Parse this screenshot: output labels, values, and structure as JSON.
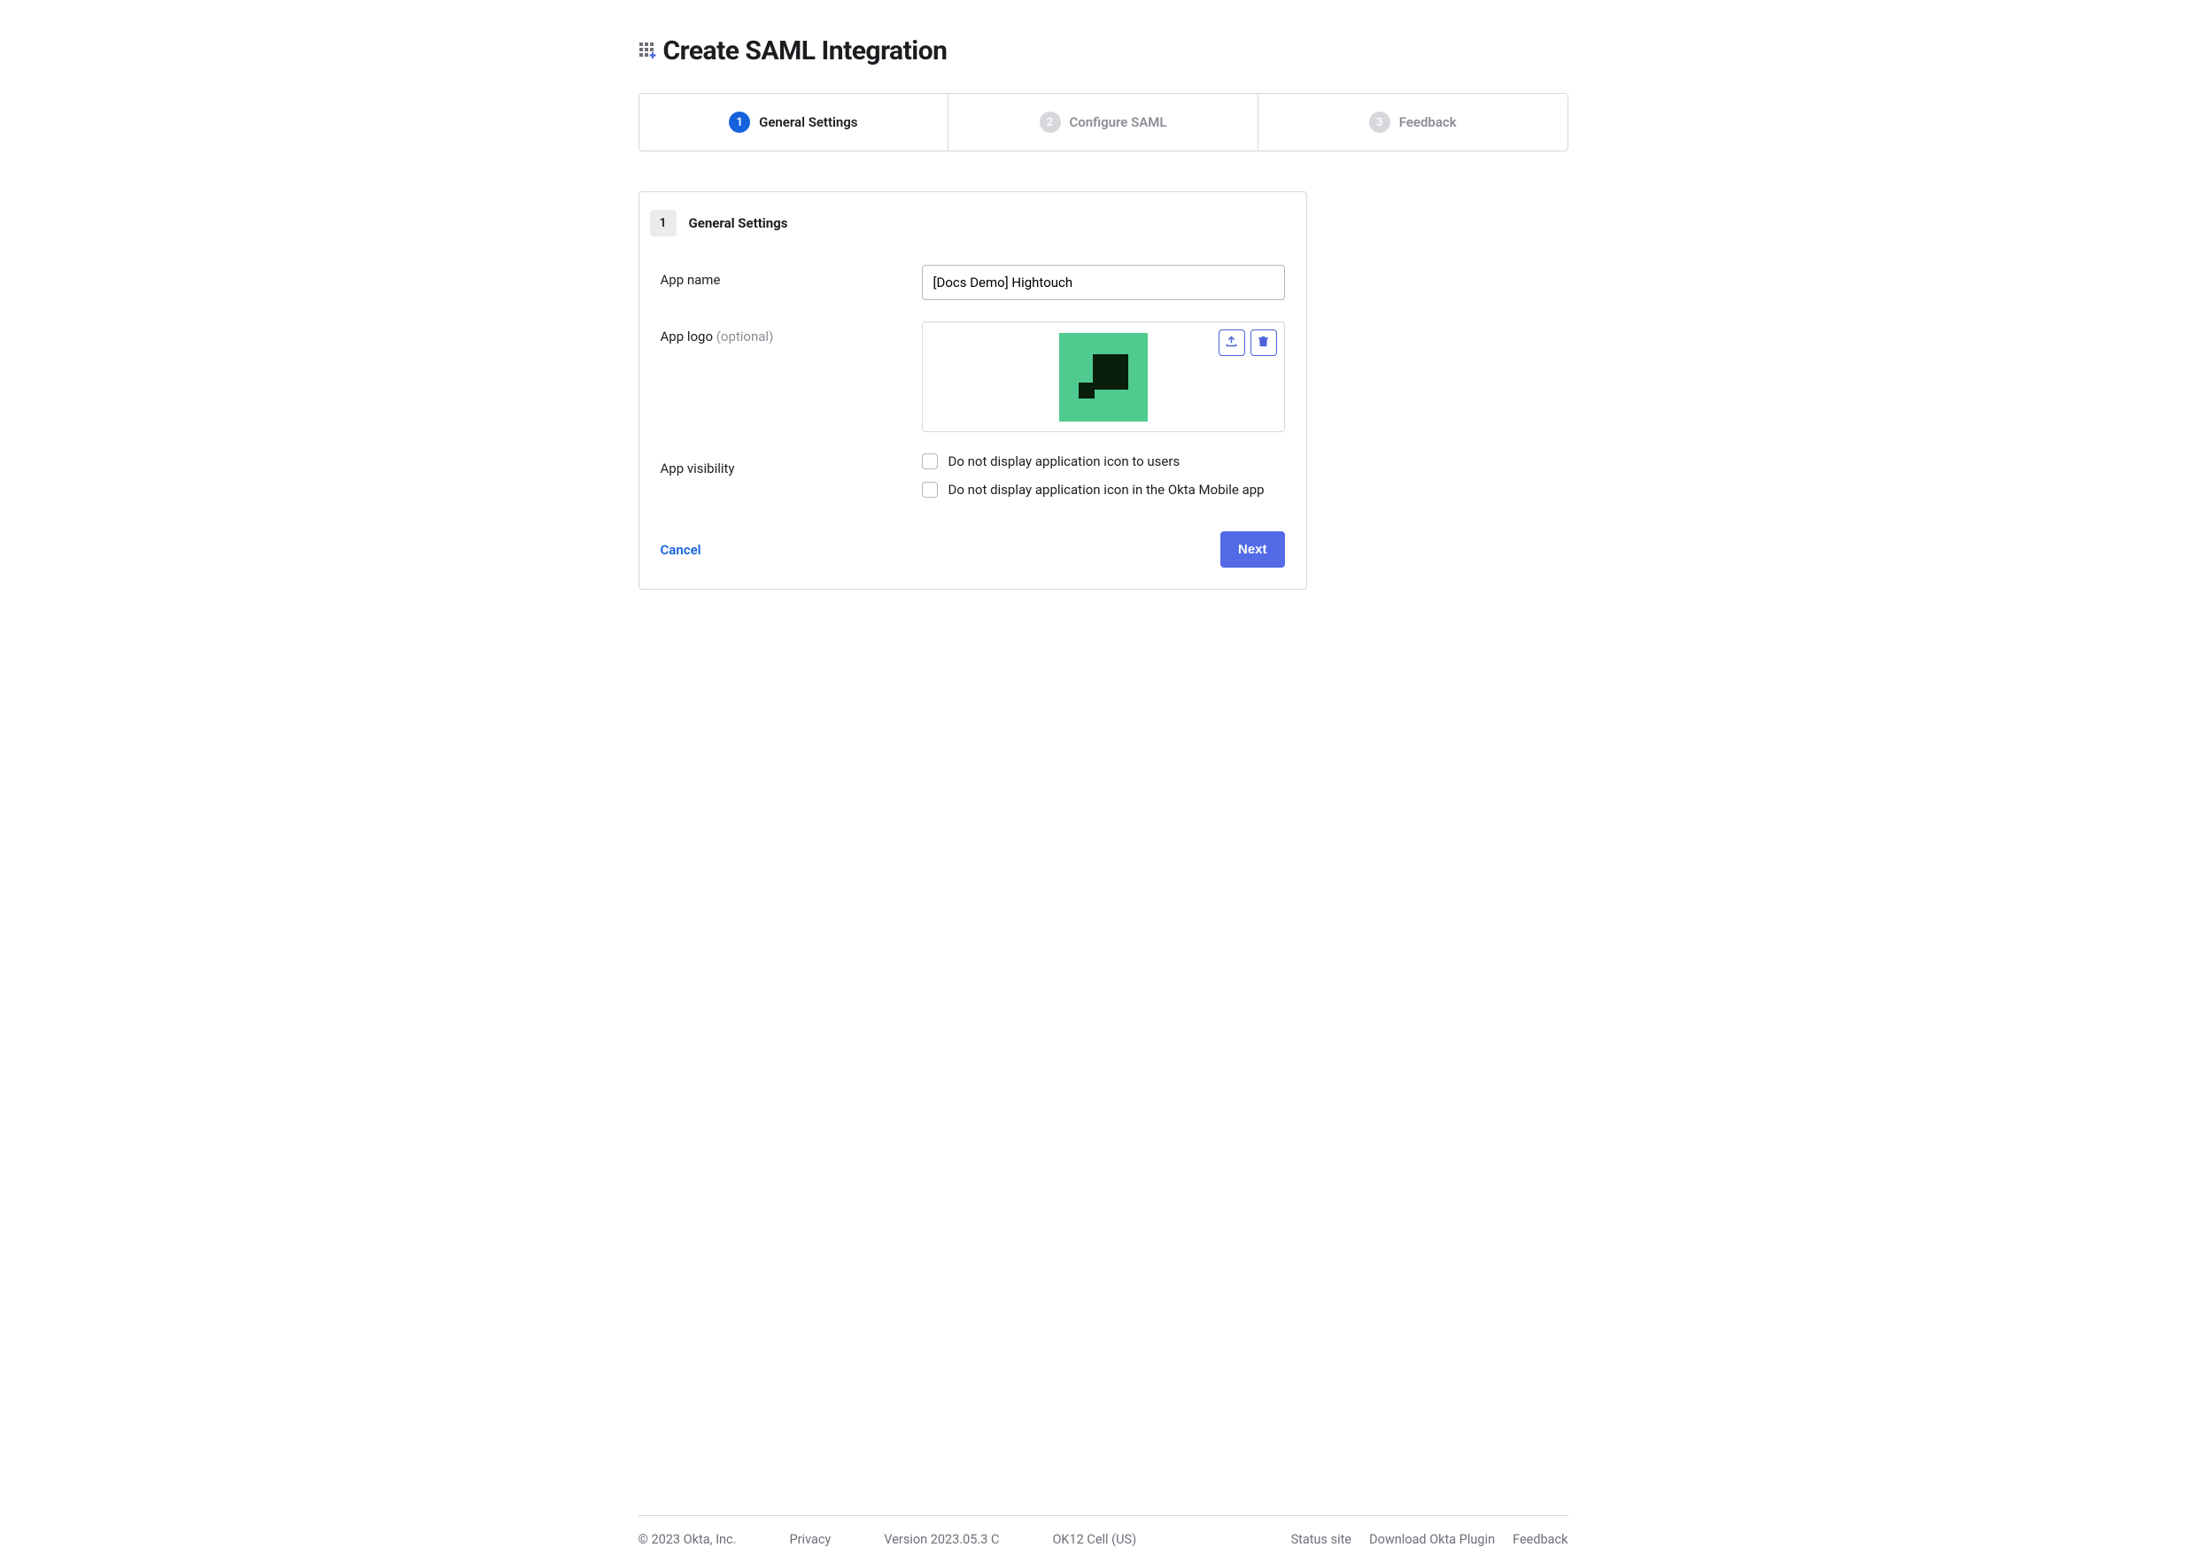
{
  "page": {
    "title": "Create SAML Integration"
  },
  "wizard": {
    "steps": [
      {
        "number": "1",
        "label": "General Settings",
        "active": true
      },
      {
        "number": "2",
        "label": "Configure SAML",
        "active": false
      },
      {
        "number": "3",
        "label": "Feedback",
        "active": false
      }
    ]
  },
  "section": {
    "number": "1",
    "title": "General Settings"
  },
  "form": {
    "app_name": {
      "label": "App name",
      "value": "[Docs Demo] Hightouch"
    },
    "app_logo": {
      "label": "App logo ",
      "optional": "(optional)"
    },
    "app_visibility": {
      "label": "App visibility",
      "options": [
        "Do not display application icon to users",
        "Do not display application icon in the Okta Mobile app"
      ]
    },
    "actions": {
      "cancel": "Cancel",
      "next": "Next"
    }
  },
  "footer": {
    "copyright": "© 2023 Okta, Inc.",
    "privacy": "Privacy",
    "version": "Version 2023.05.3 C",
    "cell": "OK12 Cell (US)",
    "status": "Status site",
    "download": "Download Okta Plugin",
    "feedback": "Feedback"
  }
}
